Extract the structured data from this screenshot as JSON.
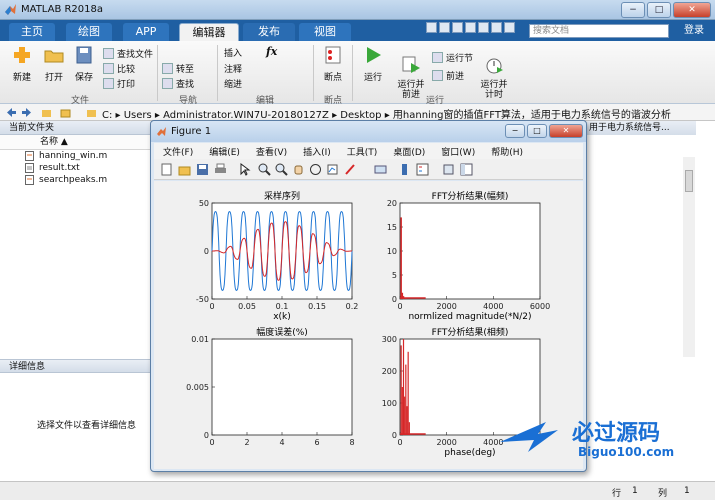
{
  "app": {
    "title": "MATLAB R2018a",
    "window_buttons": [
      "−",
      "□",
      "✕"
    ]
  },
  "tabs": [
    {
      "label": "主页"
    },
    {
      "label": "绘图"
    },
    {
      "label": "APP"
    },
    {
      "label": "编辑器"
    },
    {
      "label": "发布"
    },
    {
      "label": "视图"
    }
  ],
  "search_placeholder": "搜索文档",
  "login_label": "登录",
  "ribbon": {
    "file": {
      "new": "新建",
      "open": "打开",
      "save": "保存",
      "find_files": "查找文件",
      "compare": "比较",
      "print": "打印",
      "group": "文件"
    },
    "navigate": {
      "goto": "转至",
      "find": "查找",
      "group": "导航"
    },
    "edit": {
      "insert": "插入",
      "comment": "注释",
      "indent": "缩进",
      "group": "编辑"
    },
    "breakpoints": {
      "label": "断点",
      "group": "断点"
    },
    "run": {
      "run": "运行",
      "run_advance": "运行并\n前进",
      "run_section": "运行节",
      "advance": "前进",
      "run_time": "运行并\n计时",
      "group": "运行"
    }
  },
  "address_path": "C: ▸ Users ▸ Administrator.WIN7U-20180127Z ▸ Desktop ▸ 用hanning窗的插值FFT算法，适用于电力系统信号的谐波分析",
  "left_panel": {
    "header": "当前文件夹",
    "column": "名称 ▲",
    "files": [
      "hanning_win.m",
      "result.txt",
      "searchpeaks.m"
    ],
    "detail_header": "详细信息",
    "detail_msg": "选择文件以查看详细信息"
  },
  "right_header": "用于电力系统信号...",
  "status": {
    "row_label": "行",
    "row_value": "1",
    "col_label": "列",
    "col_value": "1"
  },
  "figure": {
    "title": "Figure 1",
    "menu": [
      "文件(F)",
      "编辑(E)",
      "查看(V)",
      "插入(I)",
      "工具(T)",
      "桌面(D)",
      "窗口(W)",
      "帮助(H)"
    ]
  },
  "colors": {
    "blue_series": "#1f77d4",
    "red_series": "#d62728",
    "ribbon_blue": "#1f5fa2"
  },
  "watermark": {
    "text1": "必过源码",
    "text2": "Biguo100.com"
  },
  "chart_data": [
    {
      "type": "line",
      "title": "采样序列",
      "xlabel": "x(k)",
      "ylabel": "",
      "xlim": [
        0,
        0.2
      ],
      "ylim": [
        -50,
        50
      ],
      "xticks": [
        "0",
        "0.05",
        "0.1",
        "0.15",
        "0.2"
      ],
      "yticks": [
        "-50",
        "0",
        "50"
      ],
      "series": [
        {
          "name": "",
          "color": "#1f77d4",
          "description_points": "sinusoid, amplitude ~45, 10 cycles over 0-0.2"
        },
        {
          "name": "",
          "color": "#d62728",
          "description_points": "hanning-windowed sinusoid, amplitude peaks ~30 at center"
        }
      ]
    },
    {
      "type": "bar",
      "title": "FFT分析结果(幅频)",
      "xlabel": "normlized magnitude(*N/2)",
      "xlim": [
        0,
        6000
      ],
      "ylim": [
        0,
        20
      ],
      "xticks": [
        "0",
        "2000",
        "4000",
        "6000"
      ],
      "yticks": [
        "0",
        "5",
        "10",
        "15",
        "20"
      ],
      "x": [
        50,
        100,
        150,
        250
      ],
      "values": [
        17,
        1.3,
        0.6,
        0.3
      ]
    },
    {
      "type": "line",
      "title": "幅度误差(%)",
      "xlabel": "",
      "xlim": [
        0,
        8
      ],
      "ylim": [
        0,
        0.01
      ],
      "xticks": [
        "0",
        "2",
        "4",
        "6",
        "8"
      ],
      "yticks": [
        "0",
        "0.005",
        "0.01"
      ],
      "series": []
    },
    {
      "type": "bar",
      "title": "FFT分析结果(相频)",
      "xlabel": "phase(deg)",
      "xlim": [
        0,
        6000
      ],
      "ylim": [
        0,
        300
      ],
      "xticks": [
        "0",
        "2000",
        "4000"
      ],
      "yticks": [
        "0",
        "100",
        "200",
        "300"
      ],
      "x": [
        50,
        100,
        150,
        200,
        250,
        300,
        350,
        400
      ],
      "values": [
        280,
        150,
        300,
        120,
        220,
        90,
        260,
        40
      ]
    }
  ]
}
